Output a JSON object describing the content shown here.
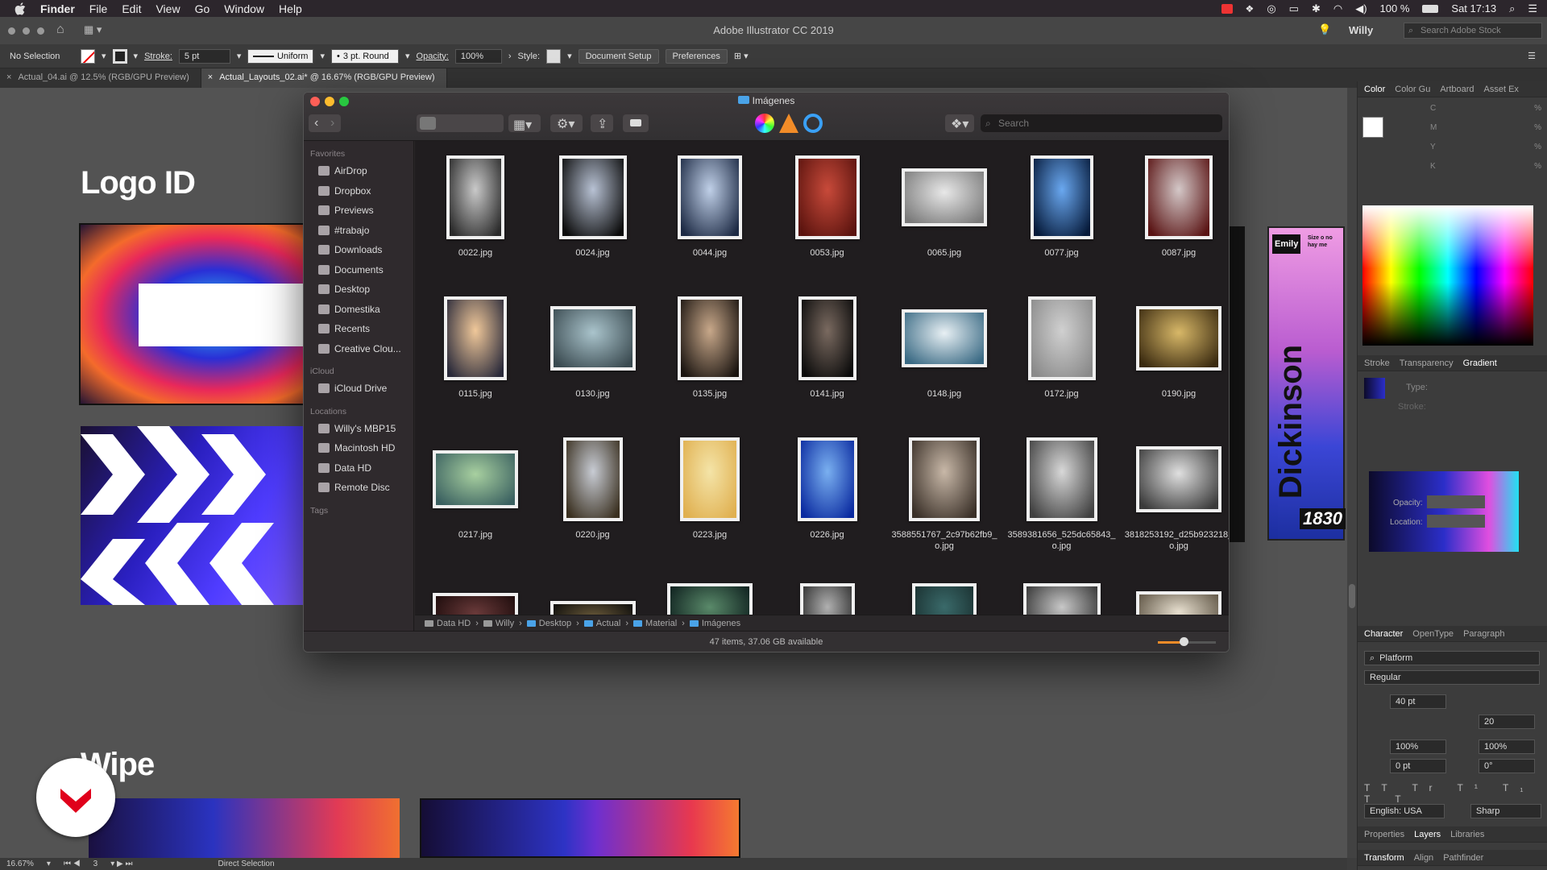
{
  "menubar": {
    "app": "Finder",
    "items": [
      "File",
      "Edit",
      "View",
      "Go",
      "Window",
      "Help"
    ],
    "battery": "100 %",
    "clock": "Sat 17:13"
  },
  "illustrator": {
    "window_title": "Adobe Illustrator CC 2019",
    "user": "Willy",
    "search_placeholder": "Search Adobe Stock",
    "control": {
      "selection": "No Selection",
      "stroke_label": "Stroke:",
      "stroke_value": "5 pt",
      "profile": "Uniform",
      "brush": "3 pt. Round",
      "opacity_label": "Opacity:",
      "opacity_value": "100%",
      "style_label": "Style:",
      "document_setup": "Document Setup",
      "preferences": "Preferences"
    },
    "doc_tabs": [
      {
        "label": "Actual_04.ai @ 12.5% (RGB/GPU Preview)",
        "active": false
      },
      {
        "label": "Actual_Layouts_02.ai* @ 16.67% (RGB/GPU Preview)",
        "active": true
      }
    ],
    "artboards": {
      "logo_title": "Logo ID",
      "wipe_title": "Wipe",
      "poster_name": "Emily",
      "poster_name2": "Dickinson",
      "poster_tagline": "Size o no hay me",
      "poster_year": "1830"
    },
    "statusbar": {
      "zoom": "16.67%",
      "artboard": "3",
      "tool": "Direct Selection"
    },
    "panels": {
      "color_tabs": [
        "Color",
        "Color Gu",
        "Artboard",
        "Asset Ex"
      ],
      "cmyk": [
        "C",
        "M",
        "Y",
        "K"
      ],
      "pct": "%",
      "stroke_tabs": [
        "Stroke",
        "Transparency",
        "Gradient"
      ],
      "gradient_type": "Type:",
      "gradient_stroke": "Stroke:",
      "gradient_opacity": "Opacity:",
      "gradient_location": "Location:",
      "char_tabs": [
        "Character",
        "OpenType",
        "Paragraph"
      ],
      "font_family": "Platform",
      "font_style": "Regular",
      "font_size": "40 pt",
      "tracking": "20",
      "vscale": "100%",
      "hscale": "100%",
      "baseline": "0 pt",
      "rotation": "0°",
      "language": "English: USA",
      "aa": "Sharp",
      "bottom_tabs": [
        "Properties",
        "Layers",
        "Libraries"
      ],
      "transform_tabs": [
        "Transform",
        "Align",
        "Pathfinder"
      ]
    }
  },
  "finder": {
    "title": "Imágenes",
    "search_placeholder": "Search",
    "sidebar": {
      "favorites_label": "Favorites",
      "favorites": [
        "AirDrop",
        "Dropbox",
        "Previews",
        "#trabajo",
        "Downloads",
        "Documents",
        "Desktop",
        "Domestika",
        "Recents",
        "Creative Clou..."
      ],
      "icloud_label": "iCloud",
      "icloud": [
        "iCloud Drive"
      ],
      "locations_label": "Locations",
      "locations": [
        "Willy's MBP15",
        "Macintosh HD",
        "Data HD",
        "Remote Disc"
      ],
      "tags_label": "Tags"
    },
    "files": [
      {
        "name": "0022.jpg",
        "c1": "#c9c9c9",
        "c2": "#2a2a2a",
        "w": 72,
        "h": 104
      },
      {
        "name": "0024.jpg",
        "c1": "#b8c2d4",
        "c2": "#0b0b0b",
        "w": 84,
        "h": 104
      },
      {
        "name": "0044.jpg",
        "c1": "#c0d0e8",
        "c2": "#1d2a44",
        "w": 80,
        "h": 104
      },
      {
        "name": "0053.jpg",
        "c1": "#c84a3a",
        "c2": "#5a130e",
        "w": 80,
        "h": 104
      },
      {
        "name": "0065.jpg",
        "c1": "#e8e8e8",
        "c2": "#7a7a7a",
        "w": 106,
        "h": 72
      },
      {
        "name": "0077.jpg",
        "c1": "#6aa8f0",
        "c2": "#061a3a",
        "w": 78,
        "h": 104
      },
      {
        "name": "0087.jpg",
        "c1": "#d4c8c8",
        "c2": "#5a1414",
        "w": 84,
        "h": 104
      },
      {
        "name": "0115.jpg",
        "c1": "#f0c89a",
        "c2": "#2a2a3a",
        "w": 78,
        "h": 104
      },
      {
        "name": "0130.jpg",
        "c1": "#aac4cc",
        "c2": "#3a4a50",
        "w": 106,
        "h": 80
      },
      {
        "name": "0135.jpg",
        "c1": "#c8a88a",
        "c2": "#1a1410",
        "w": 80,
        "h": 104
      },
      {
        "name": "0141.jpg",
        "c1": "#7a6a60",
        "c2": "#0a0a0a",
        "w": 72,
        "h": 104
      },
      {
        "name": "0148.jpg",
        "c1": "#e8f0f4",
        "c2": "#3a6a84",
        "w": 106,
        "h": 72
      },
      {
        "name": "0172.jpg",
        "c1": "#d0d0d0",
        "c2": "#8a8a8a",
        "w": 84,
        "h": 104
      },
      {
        "name": "0190.jpg",
        "c1": "#d8b868",
        "c2": "#3a2a10",
        "w": 106,
        "h": 80
      },
      {
        "name": "0217.jpg",
        "c1": "#a8d0a0",
        "c2": "#3a6060",
        "w": 106,
        "h": 72
      },
      {
        "name": "0220.jpg",
        "c1": "#c8ccd4",
        "c2": "#3a3020",
        "w": 74,
        "h": 104
      },
      {
        "name": "0223.jpg",
        "c1": "#f4e4a8",
        "c2": "#e0b050",
        "w": 74,
        "h": 104
      },
      {
        "name": "0226.jpg",
        "c1": "#7ab0f0",
        "c2": "#0a2aa0",
        "w": 74,
        "h": 104
      },
      {
        "name": "3588551767_2c97b62fb9_o.jpg",
        "c1": "#c8b8a8",
        "c2": "#3a3028",
        "w": 88,
        "h": 104
      },
      {
        "name": "3589381656_525dc65843_o.jpg",
        "c1": "#d8d8d8",
        "c2": "#404040",
        "w": 88,
        "h": 104
      },
      {
        "name": "3818253192_d25b923218_o.jpg",
        "c1": "#e0e0e0",
        "c2": "#3a3a3a",
        "w": 106,
        "h": 82
      }
    ],
    "partial_row": [
      {
        "c1": "#6a3a3a",
        "c2": "#1a0a0a",
        "w": 106,
        "h": 60
      },
      {
        "c1": "#6a5a3a",
        "c2": "#0a0a0a",
        "w": 106,
        "h": 50
      },
      {
        "c1": "#5a8a6a",
        "c2": "#0a1a1a",
        "w": 106,
        "h": 72
      },
      {
        "c1": "#b0b0b0",
        "c2": "#303030",
        "w": 68,
        "h": 72
      },
      {
        "c1": "#3a6a6a",
        "c2": "#1a3030",
        "w": 80,
        "h": 72
      },
      {
        "c1": "#c8c8c8",
        "c2": "#303030",
        "w": 96,
        "h": 72
      },
      {
        "c1": "#e8e0d0",
        "c2": "#5a5040",
        "w": 106,
        "h": 62
      }
    ],
    "path": [
      "Data HD",
      "Willy",
      "Desktop",
      "Actual",
      "Material",
      "Imágenes"
    ],
    "status": "47 items, 37.06 GB available",
    "icon_size": 0.45
  }
}
